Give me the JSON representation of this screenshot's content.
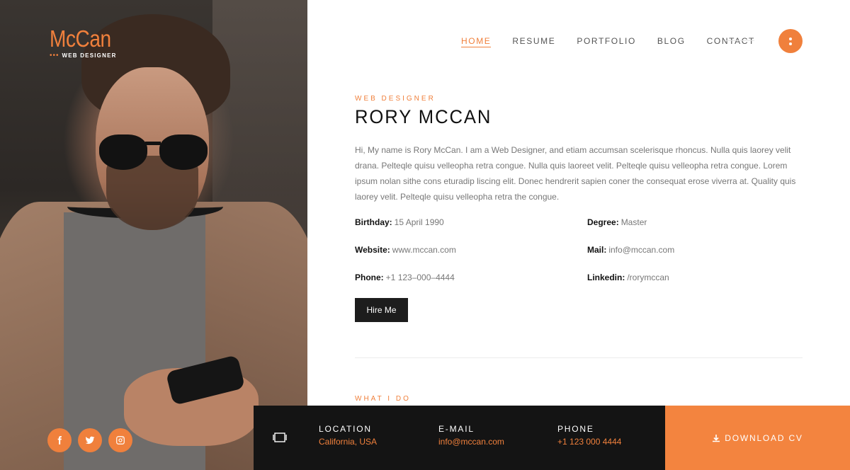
{
  "brand": {
    "logo": "McCan",
    "tagline": "WEB DESIGNER",
    "accent_color": "#f0803c"
  },
  "nav": {
    "items": [
      "HOME",
      "RESUME",
      "PORTFOLIO",
      "BLOG",
      "CONTACT"
    ],
    "active": "HOME",
    "menu_icon": "dots-vertical-icon"
  },
  "profile": {
    "role": "WEB DESIGNER",
    "name": "RORY MCCAN",
    "bio": "Hi, My name is Rory McCan. I am a Web Designer, and etiam accumsan scelerisque rhoncus. Nulla quis laorey velit drana. Pelteqle quisu velleopha retra congue. Nulla quis laoreet velit. Pelteqle quisu velleopha retra congue. Lorem ipsum nolan sithe cons eturadip liscing elit. Donec hendrerit sapien coner the consequat erose viverra at. Quality quis laorey velit. Pelteqle quisu velleopha retra the congue."
  },
  "info": {
    "birthday_label": "Birthday:",
    "birthday": "15 April 1990",
    "degree_label": "Degree:",
    "degree": "Master",
    "website_label": "Website:",
    "website": "www.mccan.com",
    "mail_label": "Mail:",
    "mail": "info@mccan.com",
    "phone_label": "Phone:",
    "phone": "+1 123–000–4444",
    "linkedin_label": "Linkedin:",
    "linkedin": "/rorymccan"
  },
  "hire_button": "Hire Me",
  "section_what_i_do": "WHAT I DO",
  "socials": [
    "facebook-icon",
    "twitter-icon",
    "instagram-icon"
  ],
  "footer": {
    "location_label": "LOCATION",
    "location": "California, USA",
    "email_label": "E-MAIL",
    "email": "info@mccan.com",
    "phone_label": "PHONE",
    "phone": "+1 123 000 4444",
    "download_label": "DOWNLOAD CV"
  }
}
